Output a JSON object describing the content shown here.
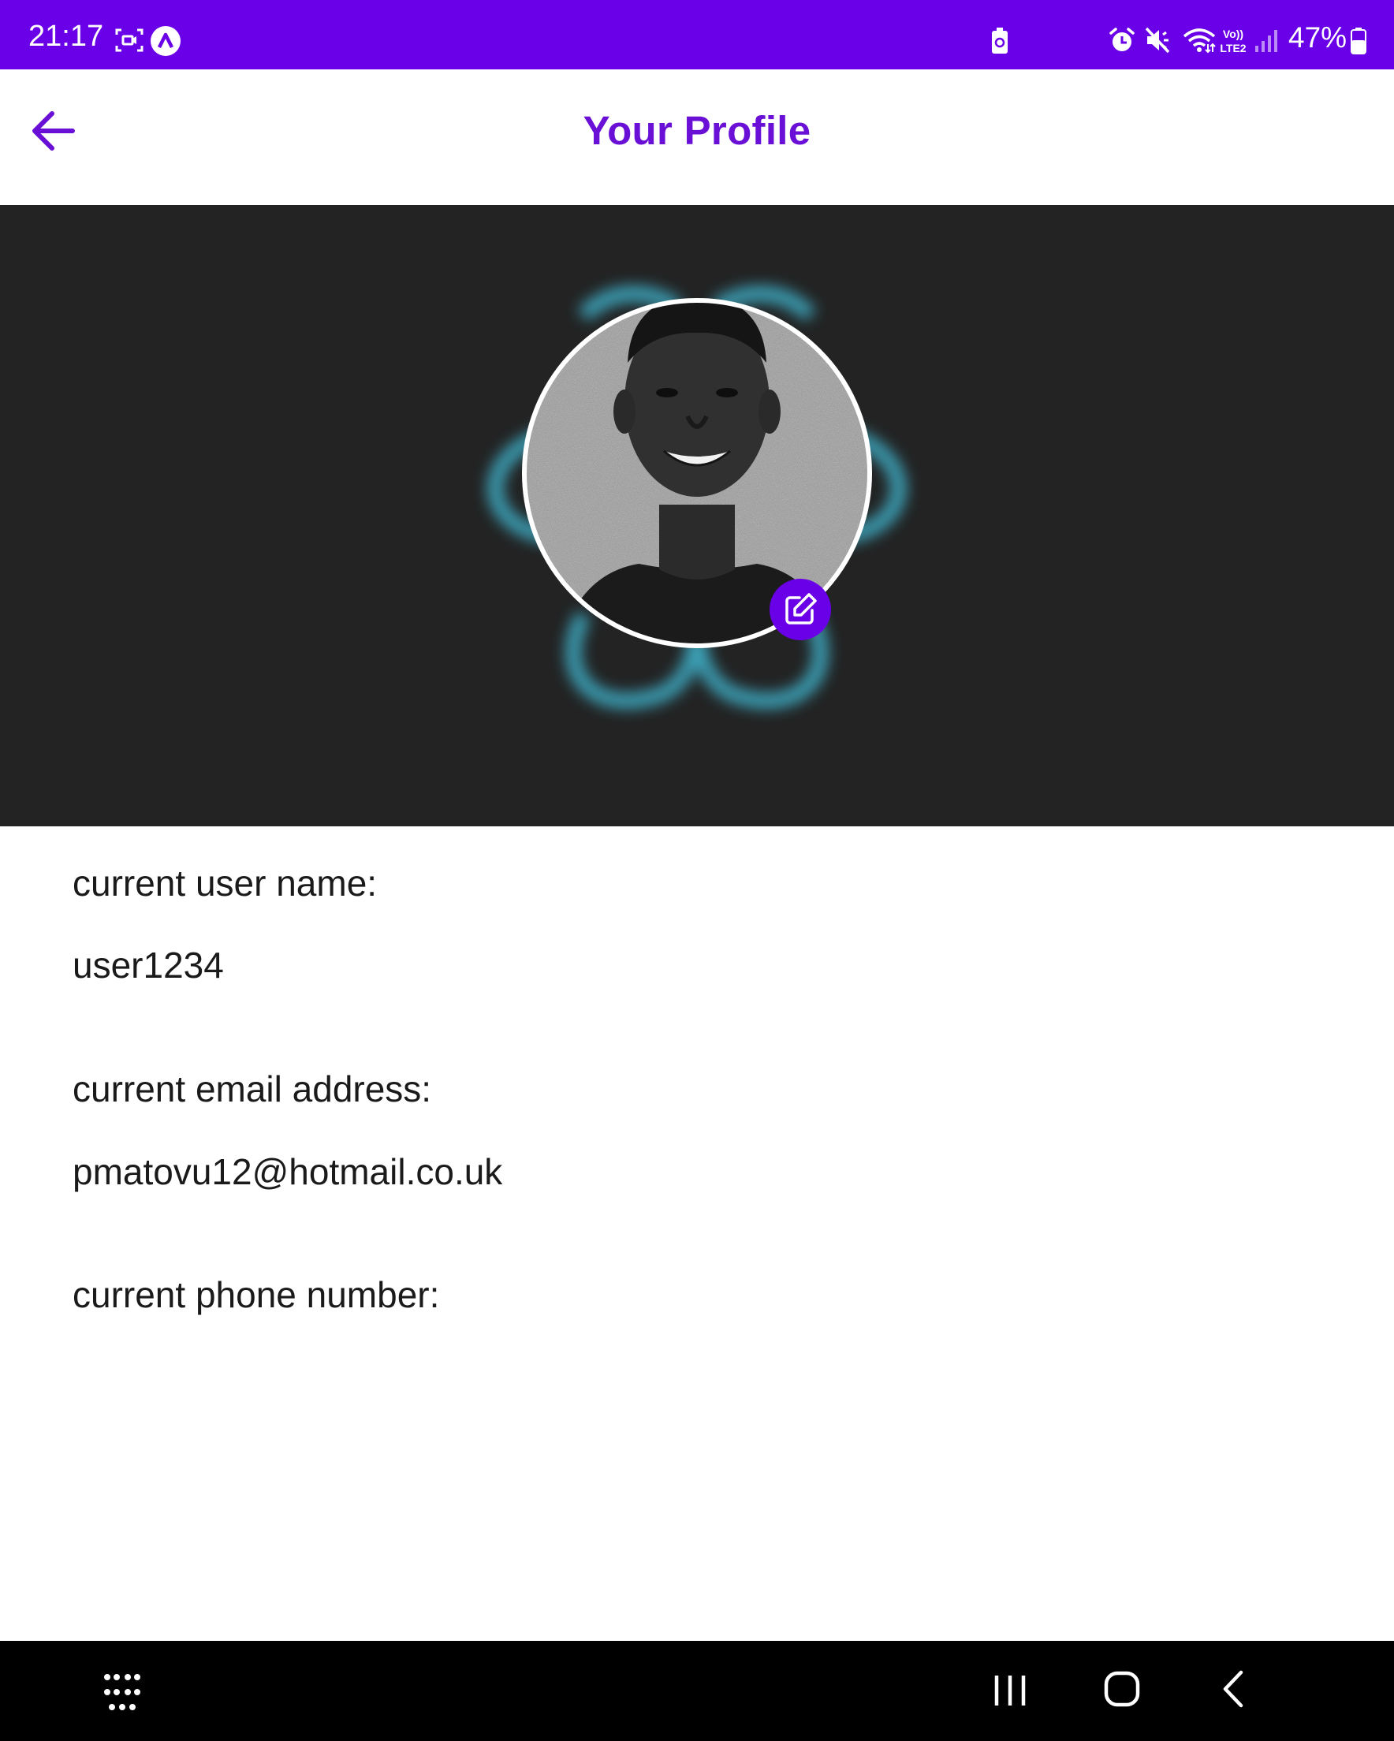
{
  "status_bar": {
    "time": "21:17",
    "battery_percent": "47%",
    "network_label": "VoLTE2",
    "icons": [
      "screen-record-icon",
      "app-a-icon",
      "battery-saver-icon",
      "alarm-icon",
      "mute-icon",
      "wifi-icon",
      "volte-icon",
      "signal-icon",
      "battery-icon"
    ]
  },
  "header": {
    "title": "Your Profile",
    "back_icon": "arrow-left-icon"
  },
  "profile": {
    "avatar_icon": "profile-photo",
    "edit_icon": "edit-icon",
    "glow_color": "#3fb6d0"
  },
  "fields": [
    {
      "label": "current user name:",
      "value": "user1234"
    },
    {
      "label": "current email address:",
      "value": "pmatovu12@hotmail.co.uk"
    },
    {
      "label": "current phone number:",
      "value": ""
    }
  ],
  "nav_bar": {
    "icons": [
      "app-drawer-icon",
      "recents-icon",
      "home-icon",
      "back-icon"
    ]
  },
  "colors": {
    "accent": "#6a00e8",
    "title": "#6a0fd6",
    "hero_bg": "#232323"
  }
}
